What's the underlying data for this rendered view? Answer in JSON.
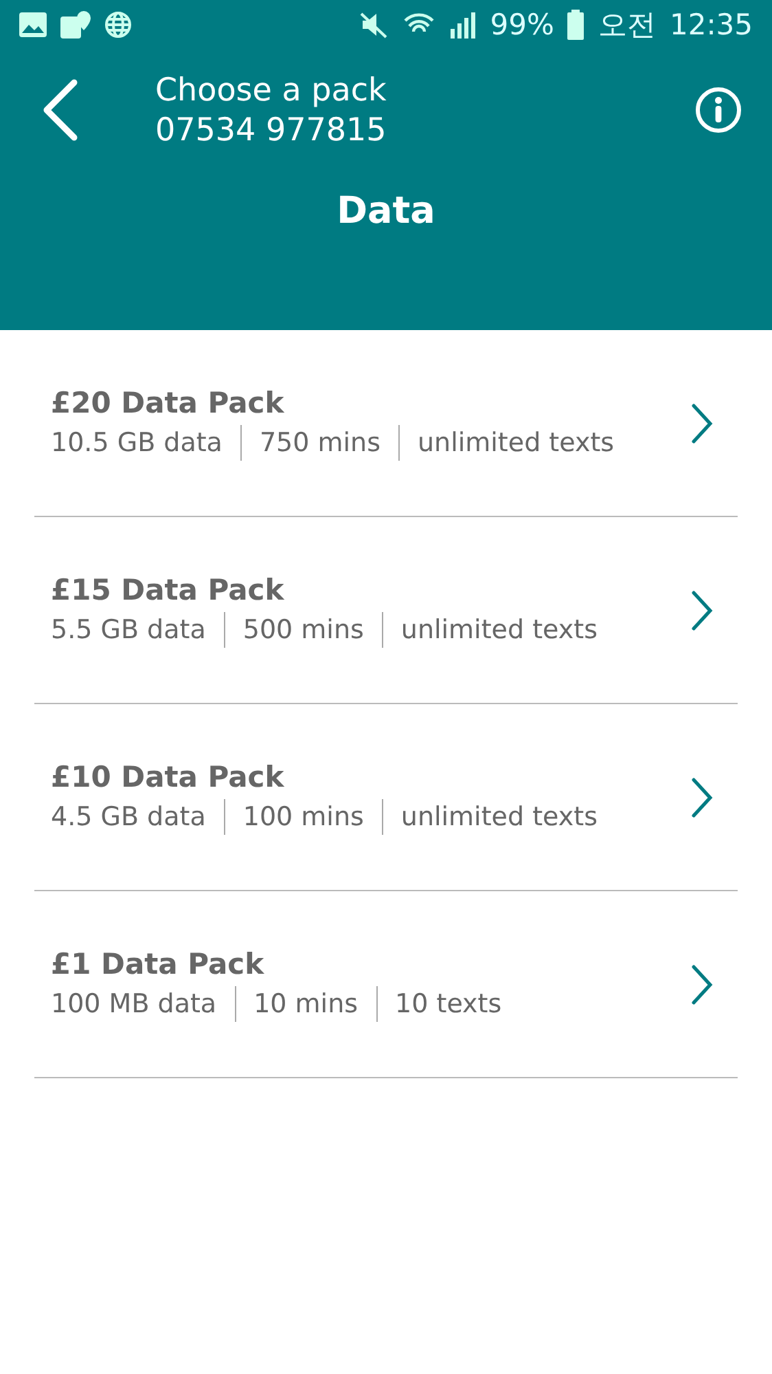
{
  "status_bar": {
    "battery": "99%",
    "ampm": "오전",
    "time": "12:35"
  },
  "header": {
    "title": "Choose a pack",
    "subtitle": "07534 977815",
    "section": "Data"
  },
  "packs": [
    {
      "name": "£20 Data Pack",
      "details": [
        "10.5 GB data",
        "750 mins",
        "unlimited texts"
      ]
    },
    {
      "name": "£15 Data Pack",
      "details": [
        "5.5 GB data",
        "500 mins",
        "unlimited texts"
      ]
    },
    {
      "name": "£10 Data Pack",
      "details": [
        "4.5 GB data",
        "100 mins",
        "unlimited texts"
      ]
    },
    {
      "name": "£1 Data Pack",
      "details": [
        "100 MB data",
        "10 mins",
        "10 texts"
      ]
    }
  ]
}
